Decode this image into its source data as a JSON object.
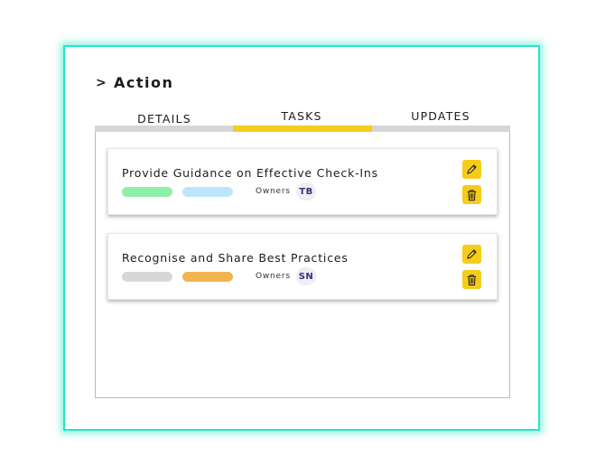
{
  "header": {
    "chevron": ">",
    "title": "Action"
  },
  "tabs": [
    {
      "label": "DETAILS",
      "active": false
    },
    {
      "label": "TASKS",
      "active": true
    },
    {
      "label": "UPDATES",
      "active": false
    }
  ],
  "tasks": [
    {
      "title": "Provide Guidance on Effective Check-Ins",
      "tag_colors": [
        "#8ef0a6",
        "#bde6fb"
      ],
      "owners_label": "Owners",
      "owner_initials": "TB",
      "actions": [
        "pencil-icon",
        "trash-icon"
      ]
    },
    {
      "title": "Recognise and Share Best Practices",
      "tag_colors": [
        "#d7d7d7",
        "#f0b451"
      ],
      "owners_label": "Owners",
      "owner_initials": "SN",
      "actions": [
        "pencil-icon",
        "trash-icon"
      ]
    }
  ],
  "colors": {
    "panel_glow": "#27e6c8",
    "accent": "#f5cc1a",
    "tab_track": "#d6d6d6",
    "badge_text": "#3f2e7a"
  }
}
